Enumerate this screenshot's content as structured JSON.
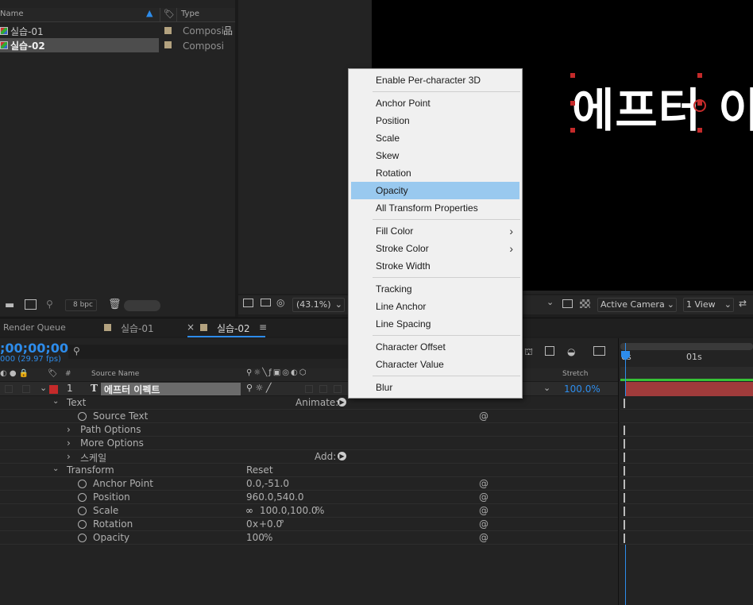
{
  "project": {
    "header_name": "Name",
    "header_type": "Type",
    "items": [
      {
        "name": "실습-01",
        "type": "Composi",
        "selected": false
      },
      {
        "name": "실습-02",
        "type": "Composi",
        "selected": true
      }
    ],
    "footer_bpc": "8 bpc"
  },
  "viewer": {
    "zoom": "(43.1%)",
    "camera": "Active Camera",
    "view": "1 View",
    "preview_text": "에프터 이"
  },
  "tabs": {
    "render_queue": "Render Queue",
    "comp1": "실습-01",
    "comp2": "실습-02",
    "close": "×"
  },
  "timeline": {
    "timecode": ";00;00;00",
    "fps": "000 (29.97 fps)",
    "search_icon": "search-icon",
    "col_num": "#",
    "col_source": "Source Name",
    "col_stretch": "Stretch",
    "layer": {
      "num": "1",
      "type": "T",
      "name": "에프터 이펙트",
      "stretch": "100.0%"
    },
    "rows": {
      "text": "Text",
      "animate": "Animate:",
      "source_text": "Source Text",
      "path_options": "Path Options",
      "more_options": "More Options",
      "scale_group": "스케일",
      "add": "Add:",
      "transform": "Transform",
      "reset": "Reset",
      "anchor_point": "Anchor Point",
      "anchor_value": "0.0,-51.0",
      "position": "Position",
      "position_value": "960.0,540.0",
      "scale": "Scale",
      "scale_value": "100.0,100.0",
      "scale_unit": "%",
      "rotation": "Rotation",
      "rotation_value_a": "0",
      "rotation_x": "x",
      "rotation_value_b": "+0.0",
      "rotation_unit": "°",
      "opacity": "Opacity",
      "opacity_value": "100",
      "opacity_unit": "%"
    },
    "ruler": {
      "t0": "0s",
      "t1": "01s"
    }
  },
  "menu": {
    "items": [
      {
        "label": "Enable Per-character 3D",
        "submenu": false
      },
      {
        "label": "Anchor Point",
        "submenu": false
      },
      {
        "label": "Position",
        "submenu": false
      },
      {
        "label": "Scale",
        "submenu": false
      },
      {
        "label": "Skew",
        "submenu": false
      },
      {
        "label": "Rotation",
        "submenu": false
      },
      {
        "label": "Opacity",
        "submenu": false,
        "highlighted": true
      },
      {
        "label": "All Transform Properties",
        "submenu": false
      },
      {
        "label": "Fill Color",
        "submenu": true
      },
      {
        "label": "Stroke Color",
        "submenu": true
      },
      {
        "label": "Stroke Width",
        "submenu": false
      },
      {
        "label": "Tracking",
        "submenu": false
      },
      {
        "label": "Line Anchor",
        "submenu": false
      },
      {
        "label": "Line Spacing",
        "submenu": false
      },
      {
        "label": "Character Offset",
        "submenu": false
      },
      {
        "label": "Character Value",
        "submenu": false
      },
      {
        "label": "Blur",
        "submenu": false
      }
    ],
    "submenu_arrow": "›"
  },
  "colors": {
    "accent_blue": "#2d8ceb",
    "menu_highlight": "#99c9ef",
    "layer_label": "#c42a2a",
    "playhead": "#2d8ceb"
  }
}
